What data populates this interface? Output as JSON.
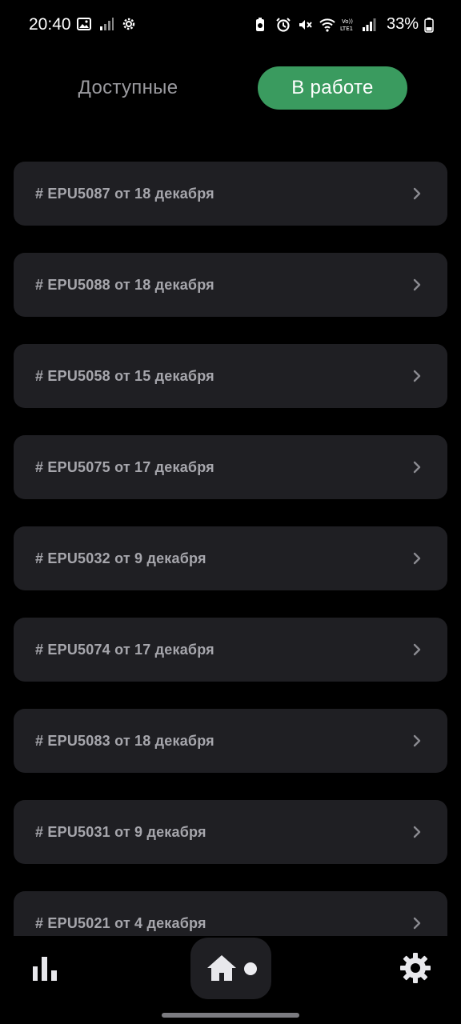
{
  "status_bar": {
    "time": "20:40",
    "battery": "33%",
    "left_icons": [
      "image-icon",
      "signal-icon",
      "settings-cog-icon"
    ],
    "right_icons": [
      "battery-saver-icon",
      "alarm-icon",
      "mute-icon",
      "wifi-icon",
      "volte-icon",
      "cell-signal-icon",
      "battery-icon"
    ]
  },
  "tabs": {
    "available": "Доступные",
    "in_work": "В работе",
    "active": "in_work",
    "active_color": "#3a9b5f"
  },
  "orders": [
    {
      "label": "# EPU5087 от 18 декабря"
    },
    {
      "label": "# EPU5088 от 18 декабря"
    },
    {
      "label": "# EPU5058 от 15 декабря"
    },
    {
      "label": "# EPU5075 от 17 декабря"
    },
    {
      "label": "# EPU5032 от 9 декабря"
    },
    {
      "label": "# EPU5074 от 17 декабря"
    },
    {
      "label": "# EPU5083 от 18 декабря"
    },
    {
      "label": "# EPU5031 от 9 декабря"
    },
    {
      "label": "# EPU5021 от 4 декабря"
    }
  ],
  "bottom_nav": {
    "items": [
      "stats-icon",
      "home-icon",
      "settings-icon"
    ],
    "active": "home-icon"
  }
}
